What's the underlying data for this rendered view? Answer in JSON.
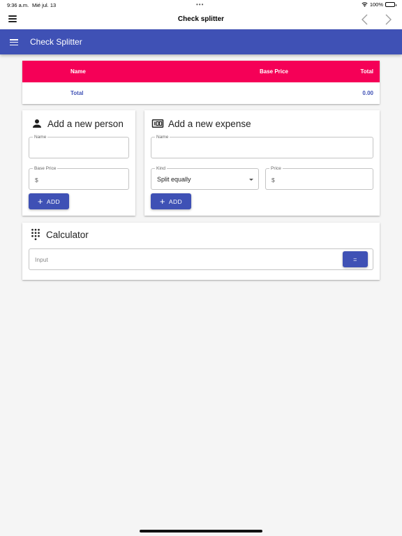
{
  "status_bar": {
    "time": "9:36 a.m.",
    "date": "Mié jul. 13",
    "dots": "•••",
    "battery": "100%",
    "wifi_icon": "wifi-icon",
    "battery_icon": "battery-icon"
  },
  "top_nav": {
    "title": "Check splitter",
    "menu_icon": "hamburger-icon",
    "back_icon": "chevron-left-icon",
    "forward_icon": "chevron-right-icon"
  },
  "app_bar": {
    "title": "Check Splitter",
    "menu_icon": "hamburger-icon"
  },
  "table": {
    "headers": [
      "Name",
      "Base Price",
      "Total"
    ],
    "total_row": {
      "label": "Total",
      "value": "0.00"
    }
  },
  "add_person": {
    "title": "Add a new person",
    "icon": "person-icon",
    "name_label": "Name",
    "name_value": "",
    "base_price_label": "Base Price",
    "currency_prefix": "$",
    "add_label": "ADD"
  },
  "add_expense": {
    "title": "Add a new expense",
    "icon": "receipt-icon",
    "name_label": "Name",
    "name_value": "",
    "kind_label": "Kind",
    "kind_selected": "Split equally",
    "price_label": "Price",
    "currency_prefix": "$",
    "add_label": "ADD"
  },
  "calculator": {
    "title": "Calculator",
    "icon": "dialpad-icon",
    "input_placeholder": "Input",
    "equals_label": "="
  },
  "colors": {
    "primary": "#3f51b5",
    "accent": "#f50057",
    "background": "#f5f5f5"
  }
}
